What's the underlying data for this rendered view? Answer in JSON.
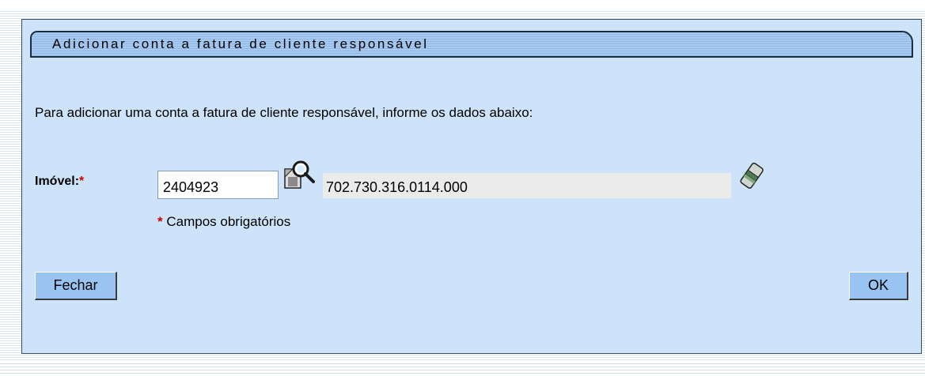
{
  "dialog": {
    "title": "Adicionar conta a fatura de cliente responsável",
    "instructions": "Para adicionar uma conta a fatura de cliente responsável, informe os dados abaixo:"
  },
  "form": {
    "imovel_label": "Imóvel:",
    "required_marker": "*",
    "imovel_code": "2404923",
    "imovel_description": "702.730.316.0114.000",
    "required_note": "Campos obrigatórios",
    "search_icon": "magnifier-icon",
    "clear_icon": "eraser-icon"
  },
  "buttons": {
    "close_label": "Fechar",
    "ok_label": "OK"
  },
  "colors": {
    "panel_background": "#cde3f9",
    "title_bar": "#a8caf0",
    "button_background": "#99c3f0",
    "required_red": "#d40000",
    "readonly_field": "#ebebeb"
  }
}
